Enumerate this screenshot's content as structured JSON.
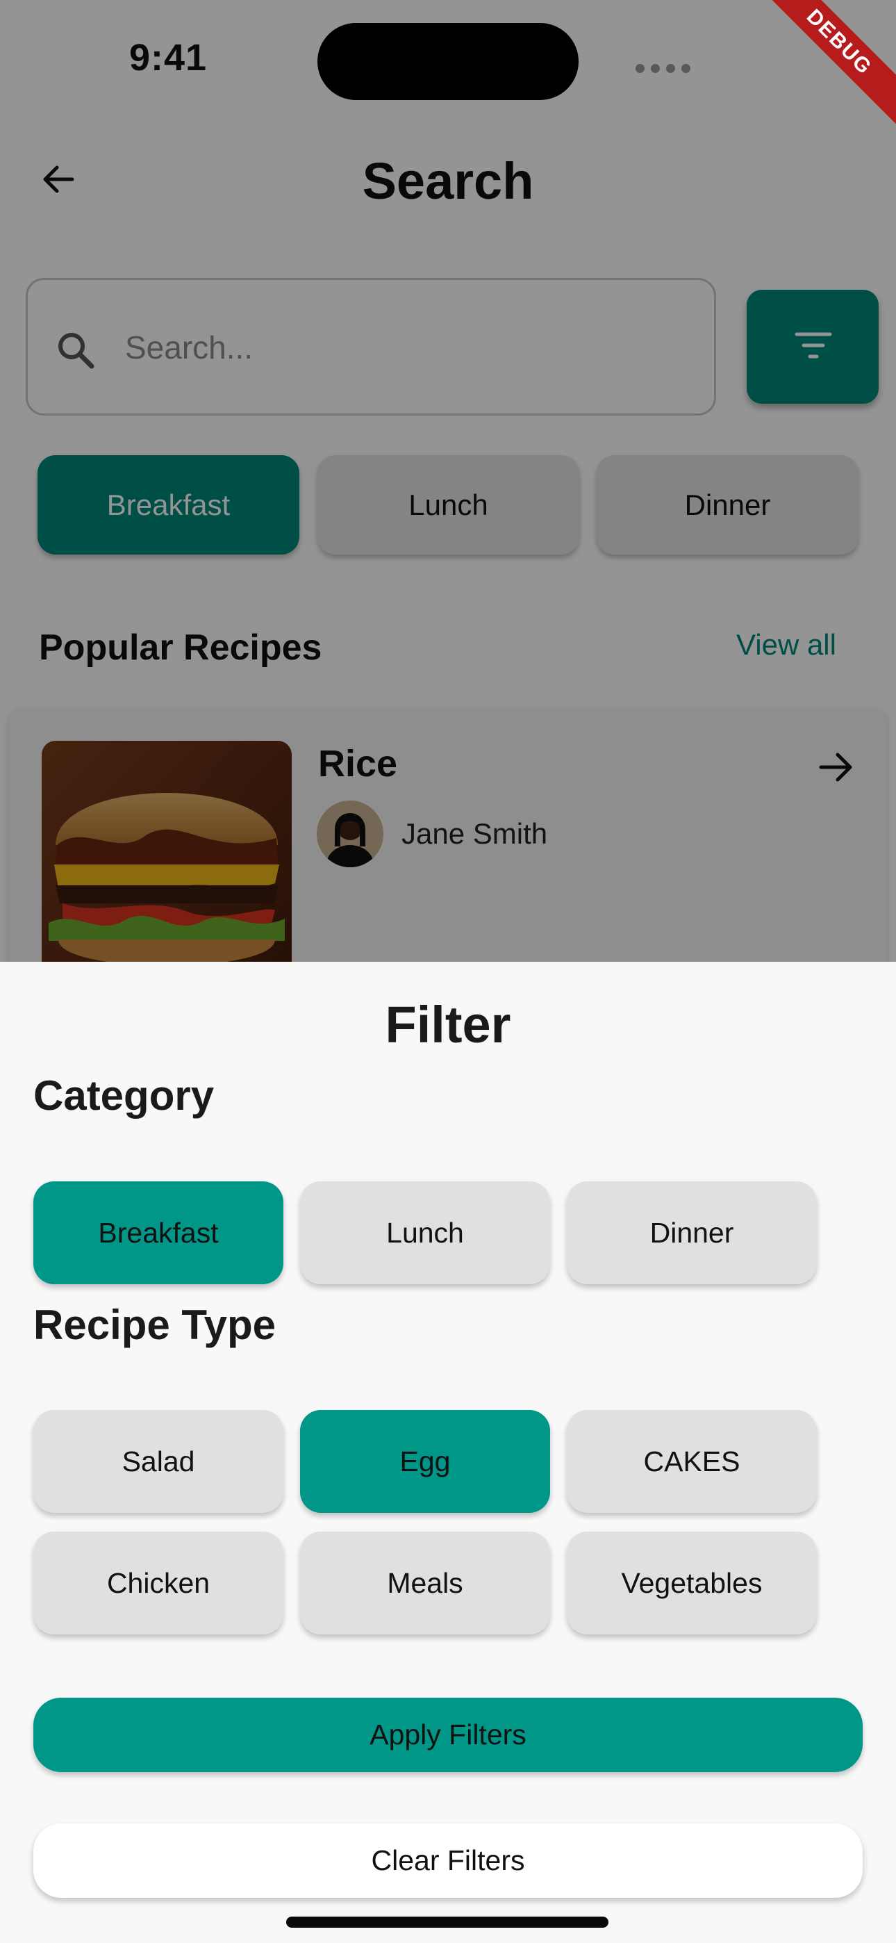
{
  "status_bar": {
    "time": "9:41",
    "debug_label": "DEBUG"
  },
  "header": {
    "title": "Search"
  },
  "search": {
    "placeholder": "Search..."
  },
  "meal_chips": [
    {
      "label": "Breakfast",
      "selected": true
    },
    {
      "label": "Lunch",
      "selected": false
    },
    {
      "label": "Dinner",
      "selected": false
    }
  ],
  "popular": {
    "title": "Popular Recipes",
    "view_all": "View all"
  },
  "recipe": {
    "name": "Rice",
    "author": "Jane Smith"
  },
  "filter_sheet": {
    "title": "Filter",
    "category_label": "Category",
    "categories": [
      {
        "label": "Breakfast",
        "selected": true
      },
      {
        "label": "Lunch",
        "selected": false
      },
      {
        "label": "Dinner",
        "selected": false
      }
    ],
    "recipe_type_label": "Recipe Type",
    "recipe_types": [
      {
        "label": "Salad",
        "selected": false
      },
      {
        "label": "Egg",
        "selected": true
      },
      {
        "label": "CAKES",
        "selected": false
      },
      {
        "label": "Chicken",
        "selected": false
      },
      {
        "label": "Meals",
        "selected": false
      },
      {
        "label": "Vegetables",
        "selected": false
      }
    ],
    "apply_label": "Apply Filters",
    "clear_label": "Clear Filters"
  },
  "colors": {
    "accent": "#009688",
    "chip_unselected": "#e0e0e0",
    "link": "#00897b",
    "debug": "#b71c1c"
  },
  "icons": [
    "back-arrow-icon",
    "search-icon",
    "filter-icon",
    "arrow-right-icon",
    "wifi-icon",
    "battery-icon",
    "signal-icon"
  ]
}
